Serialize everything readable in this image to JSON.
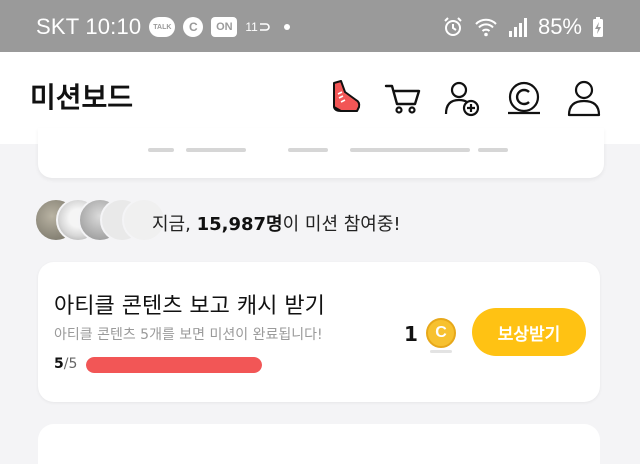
{
  "status_bar": {
    "carrier": "SKT",
    "time": "10:10",
    "notif_talk": "TALK",
    "notif_c": "C",
    "notif_on": "ON",
    "notif_11st": "11",
    "battery": "85%"
  },
  "header": {
    "title": "미션보드"
  },
  "participants": {
    "prefix": "지금, ",
    "count": "15,987명",
    "suffix": "이 미션 참여중!"
  },
  "mission": {
    "title": "아티클 콘텐츠 보고 캐시 받기",
    "subtitle": "아티클 콘텐츠 5개를 보면 미션이 완료됩니다!",
    "progress_current": "5",
    "progress_sep": "/",
    "progress_total": "5",
    "progress_fraction": 1.0,
    "reward_amount": "1",
    "coin_symbol": "C",
    "claim_label": "보상받기"
  },
  "colors": {
    "accent_yellow": "#ffc213",
    "progress_red": "#f25656",
    "coin_gold": "#f7c12f",
    "sneaker_red": "#f25656"
  },
  "icons": [
    "sneaker-icon",
    "cart-icon",
    "add-user-icon",
    "coin-history-icon",
    "profile-icon"
  ]
}
